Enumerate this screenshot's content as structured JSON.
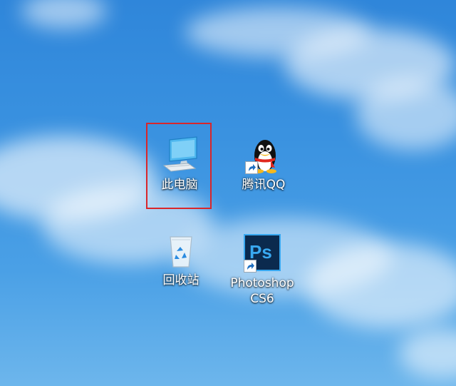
{
  "desktop": {
    "icons": [
      {
        "label": "此电脑",
        "icon": "this-pc-icon",
        "selected": true
      },
      {
        "label": "腾讯QQ",
        "icon": "qq-penguin-icon",
        "shortcut": true
      },
      {
        "label": "回收站",
        "icon": "recycle-bin-icon"
      },
      {
        "label": "Photoshop\nCS6",
        "icon": "photoshop-icon",
        "shortcut": true,
        "badge": "Ps"
      }
    ]
  },
  "colors": {
    "selection_border": "#d9262a",
    "photoshop_bg": "#0b2a4e",
    "photoshop_accent": "#39a8f0"
  }
}
